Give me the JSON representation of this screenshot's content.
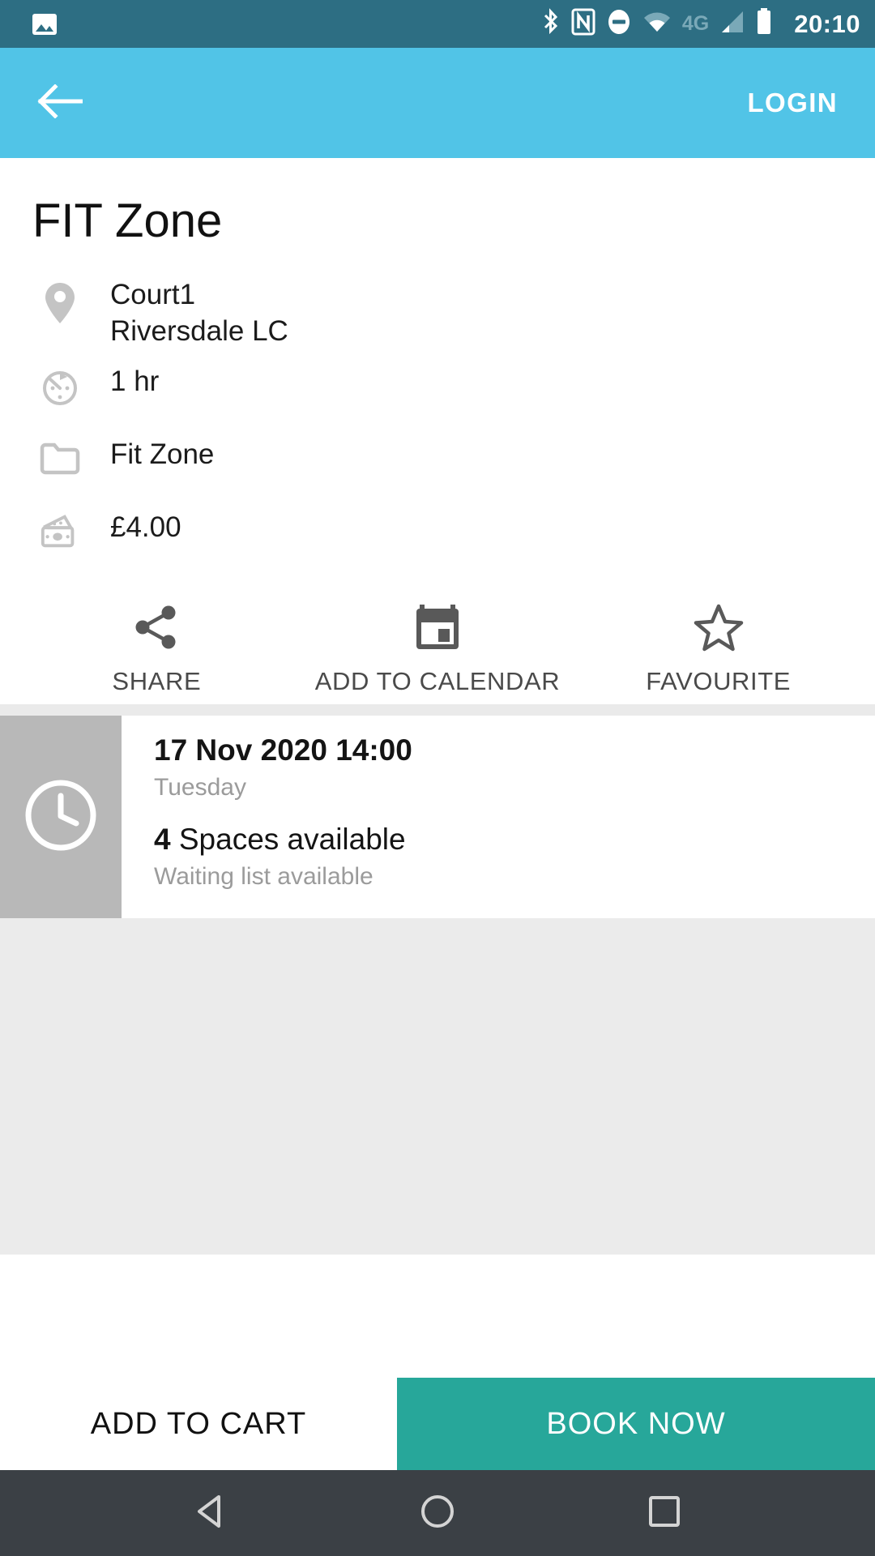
{
  "status_bar": {
    "background": "#2d6e83",
    "time": "20:10",
    "network_label": "4G",
    "icons": [
      "image-icon",
      "bluetooth-icon",
      "nfc-icon",
      "do-not-disturb-icon",
      "wifi-icon",
      "signal-icon",
      "battery-icon"
    ]
  },
  "app_bar": {
    "background": "#51c4e7",
    "back_icon": "back-arrow-icon",
    "login_label": "LOGIN"
  },
  "main": {
    "title": "FIT Zone",
    "details": [
      {
        "icon": "location-pin-icon",
        "primary": "Court1",
        "secondary": "Riversdale LC"
      },
      {
        "icon": "timer-icon",
        "primary": "1 hr",
        "secondary": ""
      },
      {
        "icon": "folder-icon",
        "primary": "Fit Zone",
        "secondary": ""
      },
      {
        "icon": "money-icon",
        "primary": "£4.00",
        "secondary": ""
      }
    ],
    "actions": [
      {
        "icon": "share-icon",
        "label": "SHARE"
      },
      {
        "icon": "calendar-icon",
        "label": "ADD TO CALENDAR"
      },
      {
        "icon": "star-icon",
        "label": "FAVOURITE"
      }
    ]
  },
  "booking": {
    "thumb_icon": "clock-icon",
    "datetime": "17 Nov 2020 14:00",
    "day": "Tuesday",
    "spaces_count": "4",
    "spaces_label": "Spaces available",
    "waiting_list": "Waiting list available"
  },
  "bottom_bar": {
    "add_to_cart_label": "ADD TO CART",
    "book_now_label": "BOOK NOW",
    "book_now_color": "#27a79a"
  },
  "nav_bar": {
    "background": "#3b4045",
    "buttons": [
      "back-triangle-icon",
      "home-circle-icon",
      "recents-square-icon"
    ]
  }
}
